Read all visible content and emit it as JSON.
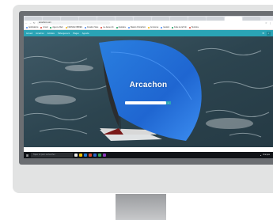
{
  "browser": {
    "tabs": [
      "",
      "",
      "",
      "",
      "",
      "",
      "",
      "",
      "",
      "",
      "",
      "",
      ""
    ],
    "active_tab_index": 11,
    "url": "arcachon.com"
  },
  "bookmarks": [
    {
      "label": "Applications",
      "color": "#4285f4"
    },
    {
      "label": "Gmail",
      "color": "#db4437"
    },
    {
      "label": "Agence Web",
      "color": "#0f9d58"
    },
    {
      "label": "FRANCE FIBRES",
      "color": "#f4b400"
    },
    {
      "label": "Création Sites",
      "color": "#4285f4"
    },
    {
      "label": "La Jaune Lib",
      "color": "#db4437"
    },
    {
      "label": "Aquitaine",
      "color": "#0f9d58"
    },
    {
      "label": "Bassin d'Arcachon",
      "color": "#4285f4"
    },
    {
      "label": "Annonces",
      "color": "#f4b400"
    },
    {
      "label": "Gestion",
      "color": "#4285f4"
    },
    {
      "label": "Faire de la Pub",
      "color": "#0f9d58"
    },
    {
      "label": "Tourisme",
      "color": "#db4437"
    }
  ],
  "site_nav": {
    "links": [
      "Accueil",
      "Arcachon",
      "Activités",
      "Hébergement",
      "Plages",
      "Agenda"
    ],
    "accent_color": "#2aa4b6"
  },
  "hero": {
    "title": "Arcachon",
    "search_icon": "search-icon"
  },
  "taskbar": {
    "search_placeholder": "Taper ici pour rechercher",
    "tray_text": "Français",
    "clock": ""
  }
}
